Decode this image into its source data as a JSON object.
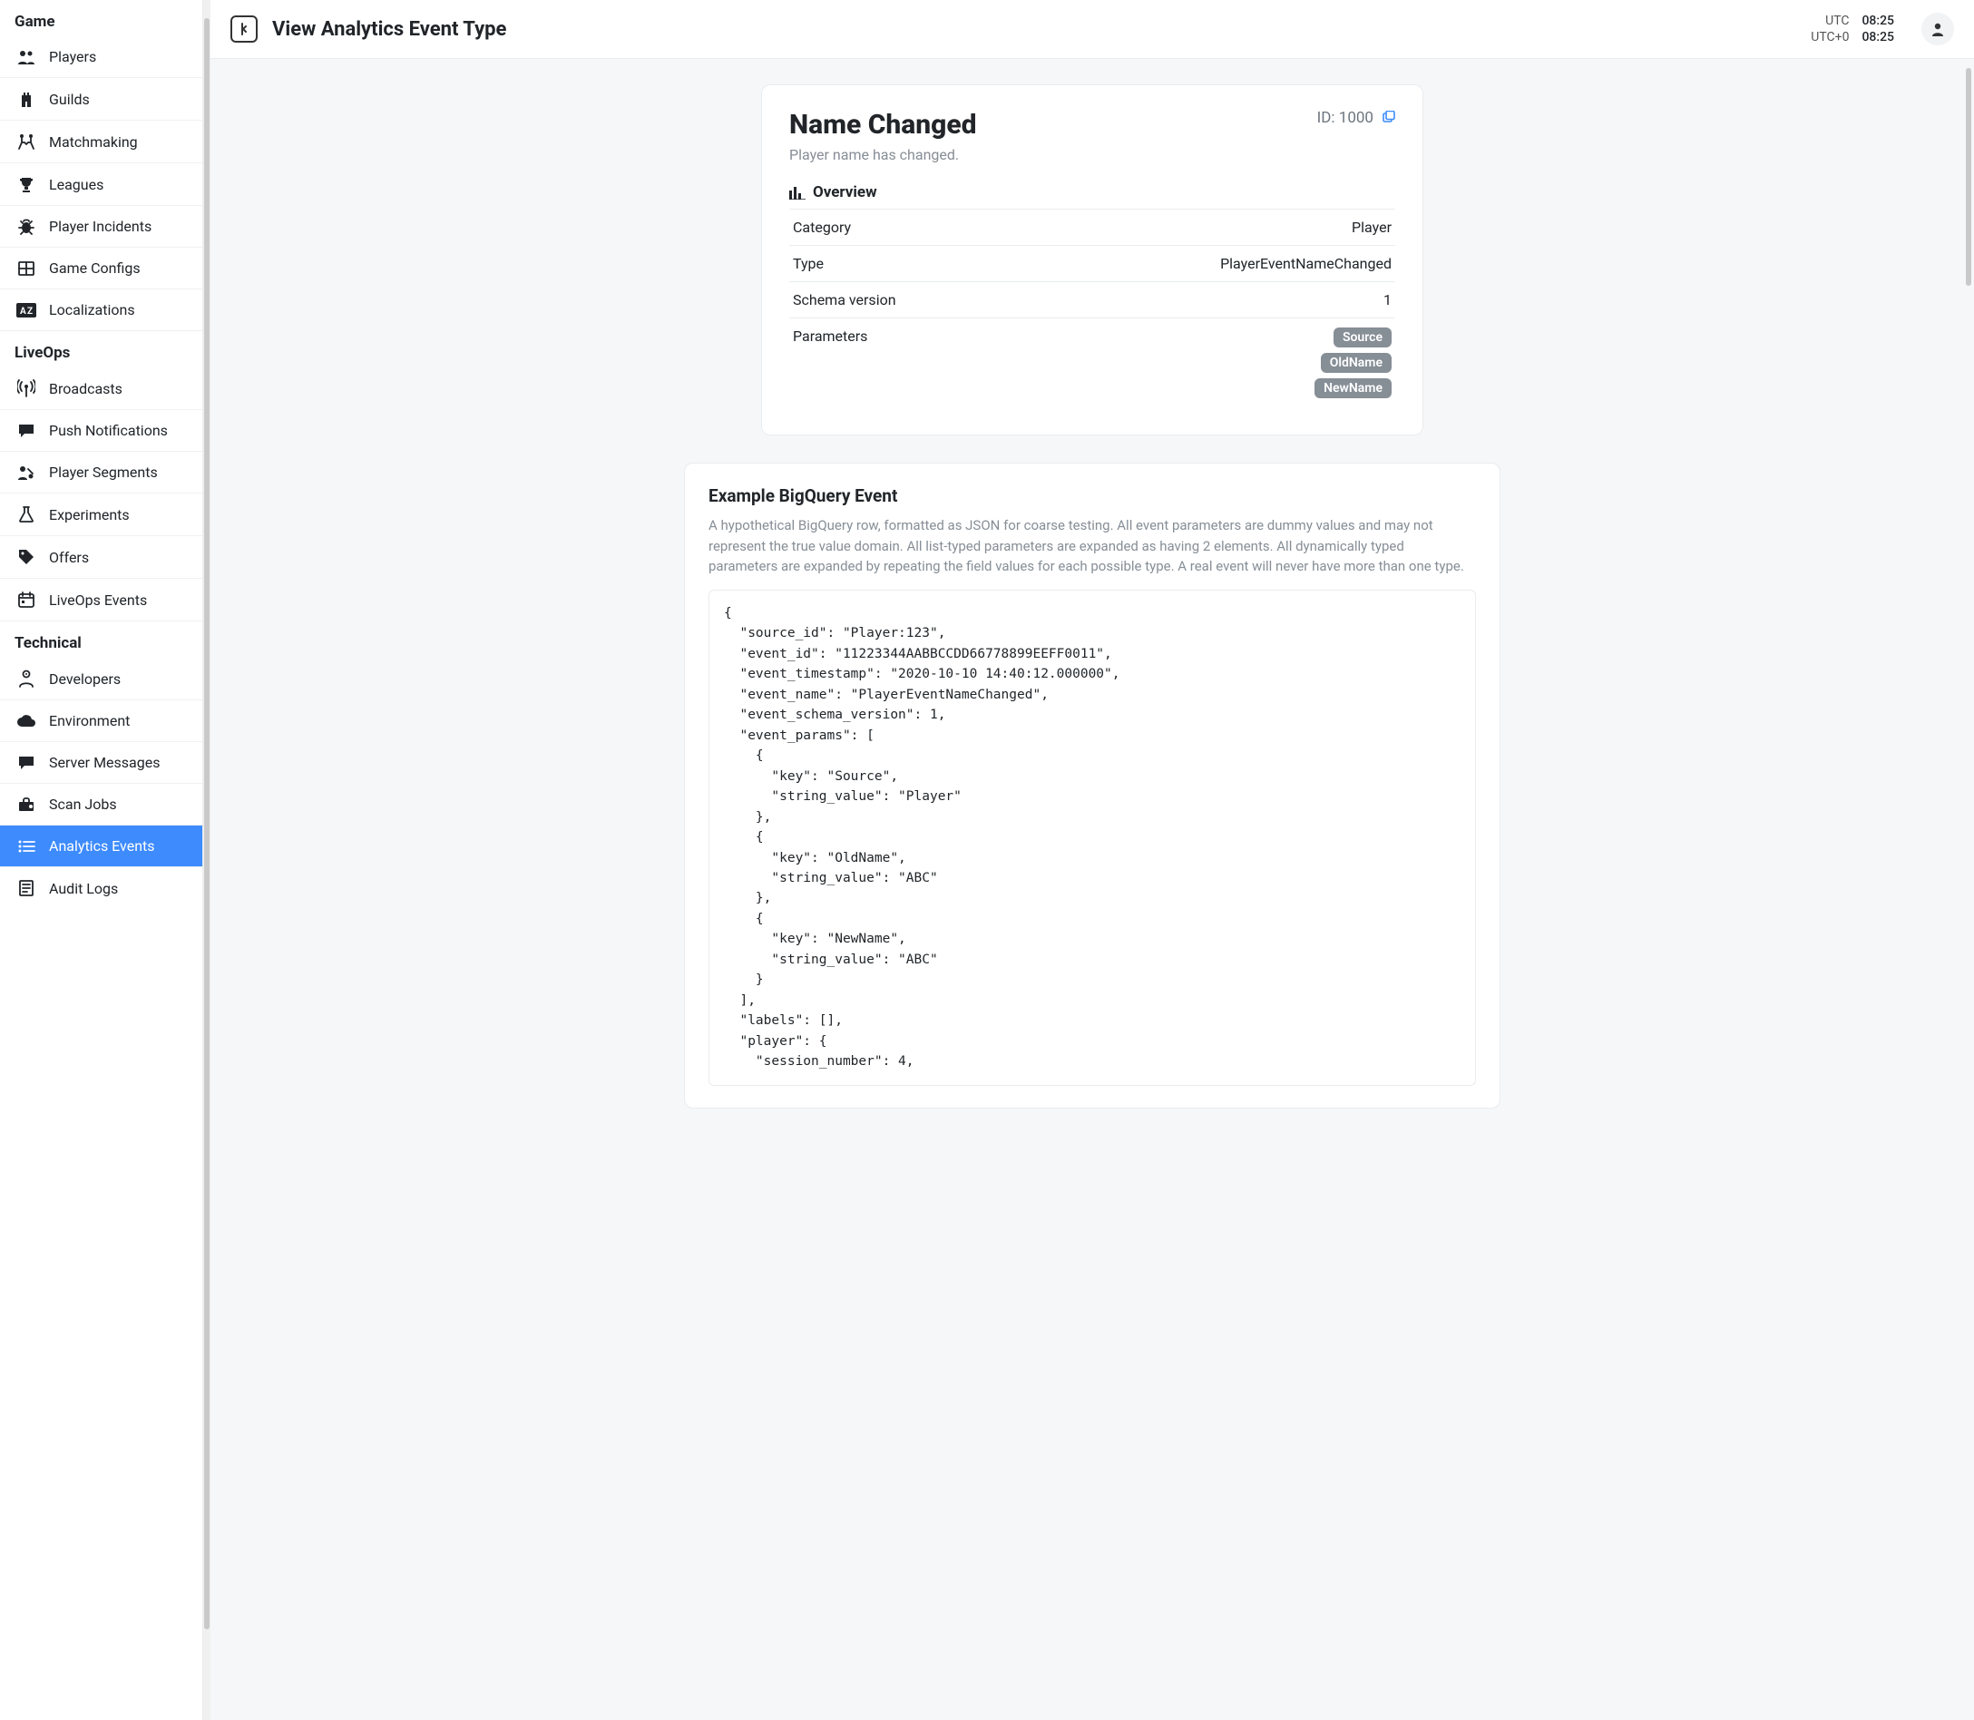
{
  "sidebar": {
    "sections": [
      {
        "title": "Game",
        "items": [
          {
            "label": "Players",
            "icon": "people"
          },
          {
            "label": "Guilds",
            "icon": "castle"
          },
          {
            "label": "Matchmaking",
            "icon": "duel"
          },
          {
            "label": "Leagues",
            "icon": "trophy"
          },
          {
            "label": "Player Incidents",
            "icon": "bug"
          },
          {
            "label": "Game Configs",
            "icon": "grid"
          },
          {
            "label": "Localizations",
            "icon": "az"
          }
        ]
      },
      {
        "title": "LiveOps",
        "items": [
          {
            "label": "Broadcasts",
            "icon": "antenna"
          },
          {
            "label": "Push Notifications",
            "icon": "chat"
          },
          {
            "label": "Player Segments",
            "icon": "segments"
          },
          {
            "label": "Experiments",
            "icon": "flask"
          },
          {
            "label": "Offers",
            "icon": "tag"
          },
          {
            "label": "LiveOps Events",
            "icon": "calendar"
          }
        ]
      },
      {
        "title": "Technical",
        "items": [
          {
            "label": "Developers",
            "icon": "person"
          },
          {
            "label": "Environment",
            "icon": "cloud"
          },
          {
            "label": "Server Messages",
            "icon": "chat"
          },
          {
            "label": "Scan Jobs",
            "icon": "toolbox"
          },
          {
            "label": "Analytics Events",
            "icon": "list",
            "active": true
          },
          {
            "label": "Audit Logs",
            "icon": "log"
          }
        ]
      }
    ]
  },
  "header": {
    "title": "View Analytics Event Type",
    "tz1_label": "UTC",
    "tz1_time": "08:25",
    "tz2_label": "UTC+0",
    "tz2_time": "08:25"
  },
  "event": {
    "title": "Name Changed",
    "desc": "Player name has changed.",
    "id_label": "ID: 1000",
    "overview_label": "Overview",
    "rows": {
      "category_label": "Category",
      "category_value": "Player",
      "type_label": "Type",
      "type_value": "PlayerEventNameChanged",
      "schema_label": "Schema version",
      "schema_value": "1",
      "params_label": "Parameters"
    },
    "params": [
      "Source",
      "OldName",
      "NewName"
    ]
  },
  "example": {
    "title": "Example BigQuery Event",
    "desc": "A hypothetical BigQuery row, formatted as JSON for coarse testing. All event parameters are dummy values and may not represent the true value domain. All list-typed parameters are expanded as having 2 elements. All dynamically typed parameters are expanded by repeating the field values for each possible type. A real event will never have more than one type.",
    "code": "{\n  \"source_id\": \"Player:123\",\n  \"event_id\": \"11223344AABBCCDD66778899EEFF0011\",\n  \"event_timestamp\": \"2020-10-10 14:40:12.000000\",\n  \"event_name\": \"PlayerEventNameChanged\",\n  \"event_schema_version\": 1,\n  \"event_params\": [\n    {\n      \"key\": \"Source\",\n      \"string_value\": \"Player\"\n    },\n    {\n      \"key\": \"OldName\",\n      \"string_value\": \"ABC\"\n    },\n    {\n      \"key\": \"NewName\",\n      \"string_value\": \"ABC\"\n    }\n  ],\n  \"labels\": [],\n  \"player\": {\n    \"session_number\": 4,"
  }
}
